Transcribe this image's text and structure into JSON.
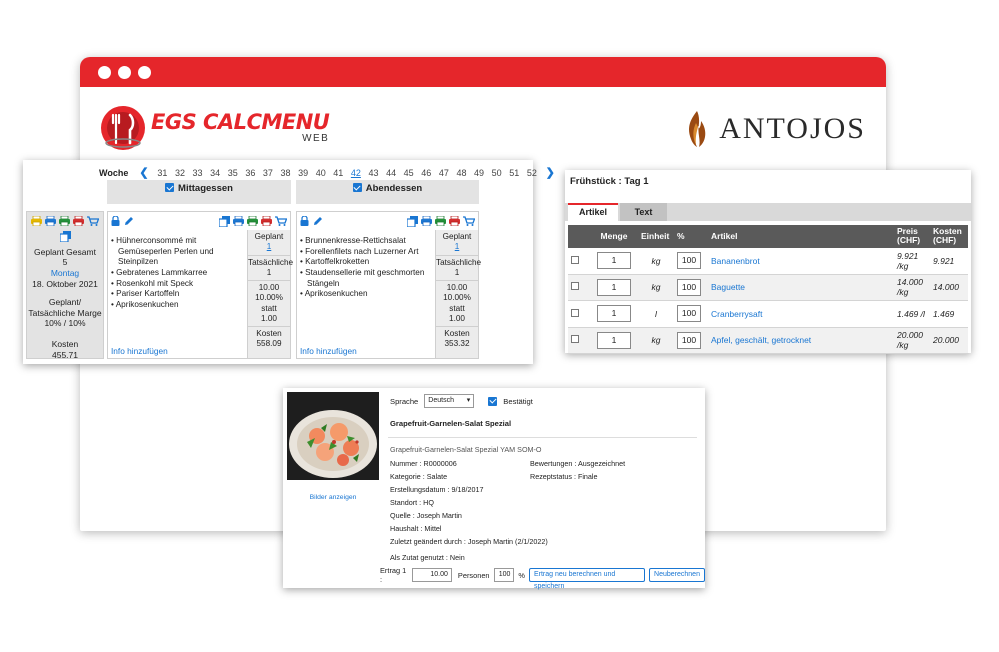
{
  "logos": {
    "left_brand": "EGS CALCMENU",
    "left_sub": "WEB",
    "right_brand": "ANTOJOS"
  },
  "planner": {
    "week_label": "Woche",
    "weeks": [
      "31",
      "32",
      "33",
      "34",
      "35",
      "36",
      "37",
      "38",
      "39",
      "40",
      "41",
      "42",
      "43",
      "44",
      "45",
      "46",
      "47",
      "48",
      "49",
      "50",
      "51",
      "52"
    ],
    "active_week": "42",
    "meals": [
      {
        "name": "Mittagessen",
        "checked": true,
        "items": [
          "Hühnerconsommé mit Gemüseperlen Perlen und Steinpilzen",
          "Gebratenes Lammkarree",
          "Rosenkohl mit Speck",
          "Pariser Kartoffeln",
          "Aprikosenkuchen"
        ],
        "info": "Info hinzufügen",
        "stats": {
          "geplant_label": "Geplant",
          "geplant": "1",
          "tats_label": "Tatsächliche",
          "tats": "1",
          "margin_a": "10.00",
          "margin_b": "10.00%",
          "statt": "statt",
          "margin_c": "1.00",
          "kosten_label": "Kosten",
          "kosten": "558.09"
        }
      },
      {
        "name": "Abendessen",
        "checked": true,
        "items": [
          "Brunnenkresse-Rettichsalat",
          "Forellenfilets nach Luzerner Art",
          "Kartoffelkroketten",
          "Staudensellerie mit geschmorten Stängeln",
          "Aprikosenkuchen"
        ],
        "info": "Info hinzufügen",
        "stats": {
          "geplant_label": "Geplant",
          "geplant": "1",
          "tats_label": "Tatsächliche",
          "tats": "1",
          "margin_a": "10.00",
          "margin_b": "10.00%",
          "statt": "statt",
          "margin_c": "1.00",
          "kosten_label": "Kosten",
          "kosten": "353.32"
        }
      }
    ],
    "summary": {
      "geplant_gesamt": "Geplant Gesamt",
      "geplant_value": "5",
      "day": "Montag",
      "date": "18. Oktober 2021",
      "margin_label": "Geplant/ Tatsächliche Marge",
      "margin_value": "10% / 10%",
      "kosten_label": "Kosten",
      "kosten_value": "455.71"
    }
  },
  "breakfast": {
    "title": "Frühstück : Tag 1",
    "tabs": [
      "Artikel",
      "Text"
    ],
    "headers": {
      "menge": "Menge",
      "einheit": "Einheit",
      "pct": "%",
      "artikel": "Artikel",
      "preis": "Preis (CHF)",
      "kosten": "Kosten (CHF)"
    },
    "rows": [
      {
        "menge": "1",
        "einheit": "kg",
        "pct": "100",
        "artikel": "Bananenbrot",
        "preis": "9.921 /kg",
        "kosten": "9.921"
      },
      {
        "menge": "1",
        "einheit": "kg",
        "pct": "100",
        "artikel": "Baguette",
        "preis": "14.000 /kg",
        "kosten": "14.000"
      },
      {
        "menge": "1",
        "einheit": "l",
        "pct": "100",
        "artikel": "Cranberrysaft",
        "preis": "1.469 /l",
        "kosten": "1.469"
      },
      {
        "menge": "1",
        "einheit": "kg",
        "pct": "100",
        "artikel": "Apfel, geschält, getrocknet",
        "preis": "20.000 /kg",
        "kosten": "20.000"
      }
    ]
  },
  "recipe": {
    "sprache_label": "Sprache",
    "sprache_value": "Deutsch",
    "bestaetigt": "Bestätigt",
    "title": "Grapefruit-Garnelen-Salat Spezial",
    "subtitle": "Grapefruit-Garnelen-Salat Spezial YAM SOM-O",
    "nummer": "Nummer : R0000006",
    "kategorie": "Kategorie : Salate",
    "erstellungsdatum": "Erstellungsdatum : 9/18/2017",
    "standort": "Standort : HQ",
    "quelle": "Quelle : Joseph Martin",
    "haushalt": "Haushalt : Mittel",
    "zuletzt": "Zuletzt geändert durch : Joseph Martin (2/1/2022)",
    "bewertungen": "Bewertungen : Ausgezeichnet",
    "rezeptstatus": "Rezeptstatus : Finale",
    "als_zutat": "Als Zutat genutzt : Nein",
    "bilder": "Bilder anzeigen",
    "ertrag_label": "Ertrag 1 :",
    "ertrag_value": "10.00",
    "personen_label": "Personen",
    "personen_value": "100",
    "pct": "%",
    "btn_save": "Ertrag neu berechnen und speichern",
    "btn_recalc": "Neuberechnen"
  },
  "colors": {
    "brand_red": "#e5262b",
    "link_blue": "#1976d2",
    "header_gray": "#5a5a5a"
  }
}
